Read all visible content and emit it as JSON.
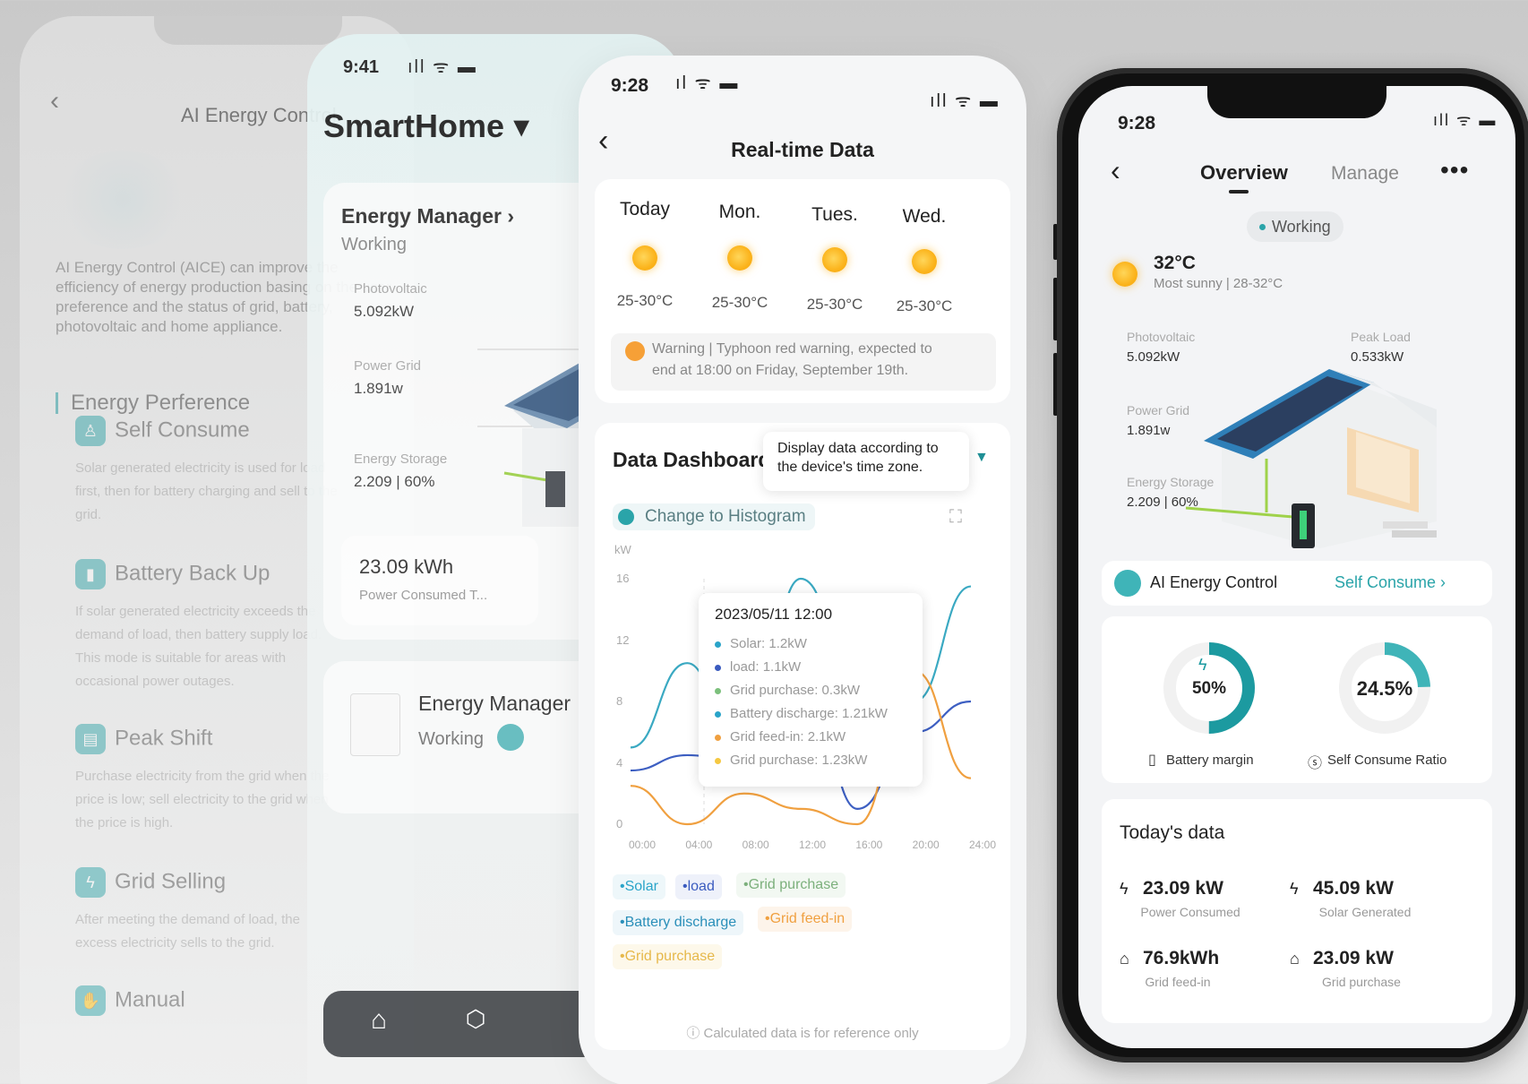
{
  "phone1": {
    "back_label": "‹",
    "title": "AI Energy Control",
    "description": "AI Energy Control (AICE) can improve the efficiency of energy production basing on the user preference and the status of grid, battery, photovoltaic and home appliance.",
    "section_title": "Energy Perference",
    "modes": [
      {
        "name": "Self Consume",
        "desc": "Solar generated electricity is used for load first, then for battery charging and sell to the grid."
      },
      {
        "name": "Battery Back Up",
        "desc": "If solar generated electricity exceeds the demand of load, then battery supply load. This mode is suitable for areas with occasional power outages."
      },
      {
        "name": "Peak Shift",
        "desc": "Purchase electricity from the grid when the price is low; sell electricity to the grid when the price is high."
      },
      {
        "name": "Grid Selling",
        "desc": "After meeting the demand of load, the excess electricity sells to the grid."
      },
      {
        "name": "Manual",
        "desc": ""
      }
    ]
  },
  "phone2": {
    "time": "9:41",
    "signal": "ıll ᯤ ▬",
    "home_title": "SmartHome ▾",
    "energy_manager": "Energy Manager ›",
    "status": "Working",
    "photovoltaic_label": "Photovoltaic",
    "photovoltaic_value": "5.092kW",
    "power_grid_label": "Power Grid",
    "power_grid_value": "1.891w",
    "storage_label": "Energy Storage",
    "storage_value": "2.209 | 60%",
    "consumed_value": "23.09 kWh",
    "consumed_label": "Power Consumed T...",
    "device_name": "Energy Manager",
    "device_status": "Working"
  },
  "phone3": {
    "time": "9:28",
    "title": "Real-time Data",
    "back": "‹",
    "forecast": [
      {
        "day": "Today",
        "temp": "25-30°C"
      },
      {
        "day": "Mon.",
        "temp": "25-30°C"
      },
      {
        "day": "Tues.",
        "temp": "25-30°C"
      },
      {
        "day": "Wed.",
        "temp": "25-30°C"
      }
    ],
    "warning_line1": "Warning | Typhoon red warning, expected to",
    "warning_line2": "end at 18:00 on Friday, September 19th.",
    "dashboard_title": "Data Dashboard",
    "tooltip_line1": "Display data according to",
    "tooltip_line2": "the device's time zone.",
    "histogram_label": "Change to Histogram",
    "footnote": "ⓘ Calculated data is for reference only",
    "hover": {
      "date": "2023/05/11  12:00",
      "rows": [
        {
          "label": "Solar:  1.2kW",
          "color": "#2aa4c9"
        },
        {
          "label": "load:  1.1kW",
          "color": "#3a5bbf"
        },
        {
          "label": "Grid purchase:  0.3kW",
          "color": "#7cc07c"
        },
        {
          "label": "Battery discharge:  1.21kW",
          "color": "#2aa4c9"
        },
        {
          "label": "Grid feed-in:  2.1kW",
          "color": "#f0a040"
        },
        {
          "label": "Grid purchase:  1.23kW",
          "color": "#f5c842"
        }
      ]
    },
    "legend": [
      {
        "label": "•Solar",
        "color": "#2aa4c9",
        "bg": "#eef7fa"
      },
      {
        "label": "•load",
        "color": "#3a5bbf",
        "bg": "#eef1fa"
      },
      {
        "label": "•Grid purchase",
        "color": "#7cb07c",
        "bg": "#f2f8f2"
      },
      {
        "label": "•Battery discharge",
        "color": "#2a8fb9",
        "bg": "#eef6fa"
      },
      {
        "label": "•Grid feed-in",
        "color": "#f0a040",
        "bg": "#fdf4ea"
      },
      {
        "label": "•Grid purchase",
        "color": "#e6b84a",
        "bg": "#fdf8ea"
      }
    ]
  },
  "chart_data": {
    "type": "line",
    "title": "",
    "xlabel": "",
    "ylabel": "kW",
    "x": [
      "00:00",
      "04:00",
      "08:00",
      "12:00",
      "16:00",
      "20:00",
      "24:00"
    ],
    "ylim": [
      0,
      16
    ],
    "yticks": [
      0,
      4,
      8,
      12,
      16
    ],
    "series": [
      {
        "color": "#3aa9c2",
        "values": [
          5,
          10.5,
          3,
          16,
          9,
          8,
          15.5
        ]
      },
      {
        "color": "#3d5fc2",
        "values": [
          3.5,
          4.5,
          4,
          12,
          1,
          6,
          8
        ]
      },
      {
        "color": "#f0a040",
        "values": [
          2.5,
          0,
          2,
          1,
          0,
          10,
          3
        ]
      }
    ]
  },
  "phone4": {
    "time": "9:28",
    "signal": "ıll ᯤ ▬",
    "back": "‹",
    "tab_overview": "Overview",
    "tab_manage": "Manage",
    "more": "•••",
    "status": "Working",
    "temperature": "32°C",
    "weather": "Most sunny | 28-32°C",
    "photovoltaic_label": "Photovoltaic",
    "photovoltaic_value": "5.092kW",
    "peak_label": "Peak Load",
    "peak_value": "0.533kW",
    "grid_label": "Power Grid",
    "grid_value": "1.891w",
    "storage_label": "Energy Storage",
    "storage_value": "2.209 | 60%",
    "ai_title": "AI Energy Control",
    "ai_mode": "Self Consume  ›",
    "battery_value": "50%",
    "battery_pct": 0.5,
    "battery_label": "Battery margin",
    "ratio_value": "24.5%",
    "ratio_pct": 0.245,
    "ratio_label": "Self Consume Ratio",
    "today_title": "Today's data",
    "today": [
      {
        "value": "23.09 kW",
        "label": "Power Consumed"
      },
      {
        "value": "45.09 kW",
        "label": "Solar Generated"
      },
      {
        "value": "76.9kWh",
        "label": "Grid feed-in"
      },
      {
        "value": "23.09 kW",
        "label": "Grid purchase"
      }
    ]
  }
}
